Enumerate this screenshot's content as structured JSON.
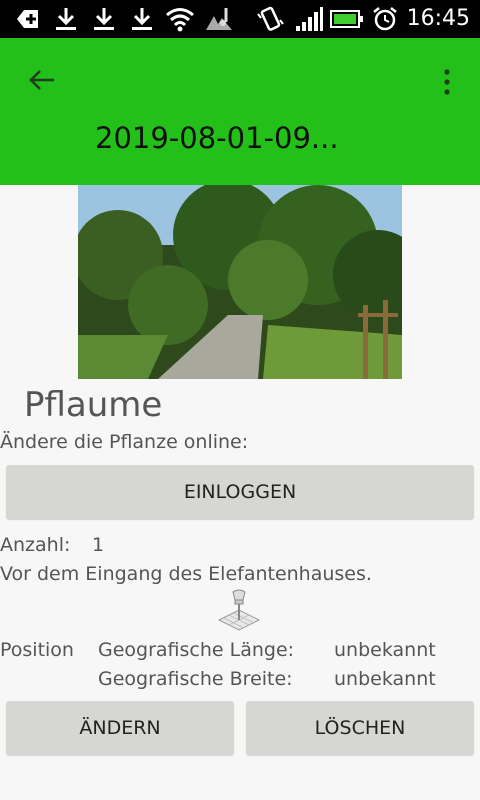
{
  "status_bar": {
    "time": "16:45",
    "icons": [
      "add-icon",
      "download-icon",
      "download-icon",
      "download-icon",
      "wifi-icon",
      "music-icon",
      "vibrate-icon",
      "signal-icon",
      "battery-icon",
      "alarm-icon"
    ]
  },
  "appbar": {
    "title": "2019-08-01-09...",
    "color": "#22c018"
  },
  "plant": {
    "name": "Pflaume",
    "edit_online_label": "Ändere die Pflanze online:",
    "login_button": "EINLOGGEN",
    "count_label": "Anzahl:",
    "count_value": "1",
    "description": "Vor dem Eingang des Elefantenhauses."
  },
  "position": {
    "label": "Position",
    "longitude_label": "Geografische Länge:",
    "longitude_value": "unbekannt",
    "latitude_label": "Geografische Breite:",
    "latitude_value": "unbekannt"
  },
  "actions": {
    "edit_button": "ÄNDERN",
    "delete_button": "LÖSCHEN"
  }
}
